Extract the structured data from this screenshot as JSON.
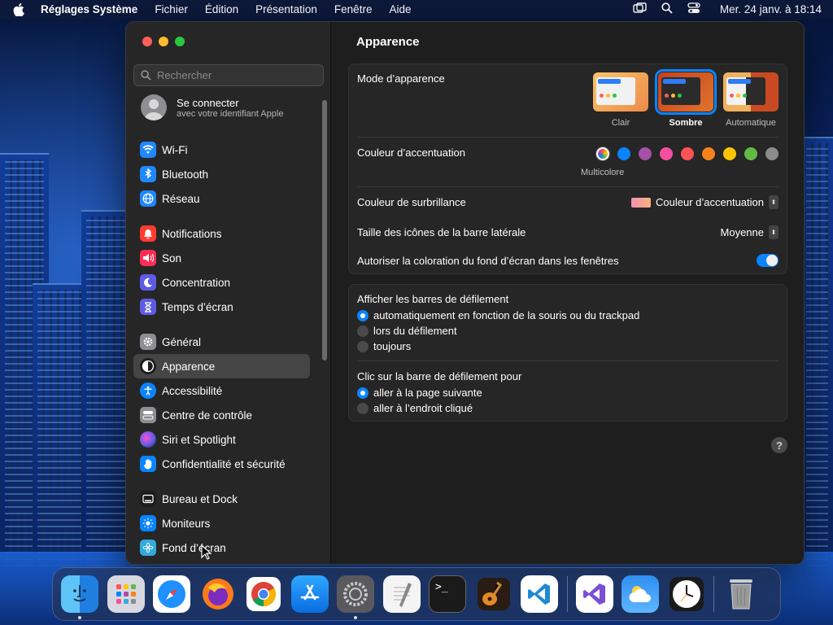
{
  "menubar": {
    "app_name": "Réglages Système",
    "menus": [
      "Fichier",
      "Édition",
      "Présentation",
      "Fenêtre",
      "Aide"
    ],
    "clock": "Mer. 24 janv. à 18:14",
    "status_icons": [
      "screen-mirroring-icon",
      "spotlight-search-icon",
      "control-center-icon"
    ]
  },
  "sidebar": {
    "search_placeholder": "Rechercher",
    "account": {
      "title": "Se connecter",
      "subtitle": "avec votre identifiant Apple"
    },
    "items": [
      {
        "label": "Wi-Fi",
        "icon": "wifi-icon",
        "color": "#1e88ff"
      },
      {
        "label": "Bluetooth",
        "icon": "bluetooth-icon",
        "color": "#1e88ff"
      },
      {
        "label": "Réseau",
        "icon": "globe-icon",
        "color": "#1e88ff"
      },
      {
        "label": "Notifications",
        "icon": "bell-icon",
        "color": "#ff3b30"
      },
      {
        "label": "Son",
        "icon": "speaker-icon",
        "color": "#ff2d55"
      },
      {
        "label": "Concentration",
        "icon": "moon-icon",
        "color": "#5e5ce6"
      },
      {
        "label": "Temps d’écran",
        "icon": "hourglass-icon",
        "color": "#5e5ce6"
      },
      {
        "label": "Général",
        "icon": "gear-icon",
        "color": "#8e8e93"
      },
      {
        "label": "Apparence",
        "icon": "appearance-icon",
        "color": "#1c1c1e"
      },
      {
        "label": "Accessibilité",
        "icon": "accessibility-icon",
        "color": "#0a84ff"
      },
      {
        "label": "Centre de contrôle",
        "icon": "toggles-icon",
        "color": "#8e8e93"
      },
      {
        "label": "Siri et Spotlight",
        "icon": "siri-icon",
        "color": "#bf5af2"
      },
      {
        "label": "Confidentialité et sécurité",
        "icon": "hand-icon",
        "color": "#0a84ff"
      },
      {
        "label": "Bureau et Dock",
        "icon": "dock-icon",
        "color": "#1c1c1e"
      },
      {
        "label": "Moniteurs",
        "icon": "sun-icon",
        "color": "#0a84ff"
      },
      {
        "label": "Fond d’écran",
        "icon": "wallpaper-icon",
        "color": "#34aadc"
      }
    ],
    "selected": "Apparence"
  },
  "main": {
    "title": "Apparence",
    "appearance_mode": {
      "label": "Mode d’apparence",
      "options": [
        {
          "label": "Clair",
          "selected": false
        },
        {
          "label": "Sombre",
          "selected": true
        },
        {
          "label": "Automatique",
          "selected": false
        }
      ]
    },
    "accent_color": {
      "label": "Couleur d’accentuation",
      "selected_name": "Multicolore",
      "colors": [
        "#multicolor",
        "#0a84ff",
        "#a550a7",
        "#f74f9e",
        "#ff5257",
        "#f7821b",
        "#ffc600",
        "#62ba46",
        "#8c8c8c"
      ]
    },
    "highlight_color": {
      "label": "Couleur de surbrillance",
      "value": "Couleur d’accentuation"
    },
    "sidebar_icon_size": {
      "label": "Taille des icônes de la barre latérale",
      "value": "Moyenne"
    },
    "wallpaper_tinting": {
      "label": "Autoriser la coloration du fond d’écran dans les fenêtres",
      "enabled": true
    },
    "scroll_bars": {
      "label": "Afficher les barres de défilement",
      "options": [
        {
          "label": "automatiquement en fonction de la souris ou du trackpad",
          "selected": true
        },
        {
          "label": "lors du défilement",
          "selected": false
        },
        {
          "label": "toujours",
          "selected": false
        }
      ]
    },
    "scroll_click": {
      "label": "Clic sur la barre de défilement pour",
      "options": [
        {
          "label": "aller à la page suivante",
          "selected": true
        },
        {
          "label": "aller à l’endroit cliqué",
          "selected": false
        }
      ]
    },
    "help": "?"
  },
  "dock": {
    "apps": [
      "Finder",
      "Launchpad",
      "Safari",
      "Firefox",
      "Chrome",
      "App Store",
      "Réglages Système",
      "TextEdit",
      "Terminal",
      "GarageBand",
      "Visual Studio Code",
      "Visual Studio",
      "Météo",
      "Horloge",
      "Corbeille"
    ]
  }
}
